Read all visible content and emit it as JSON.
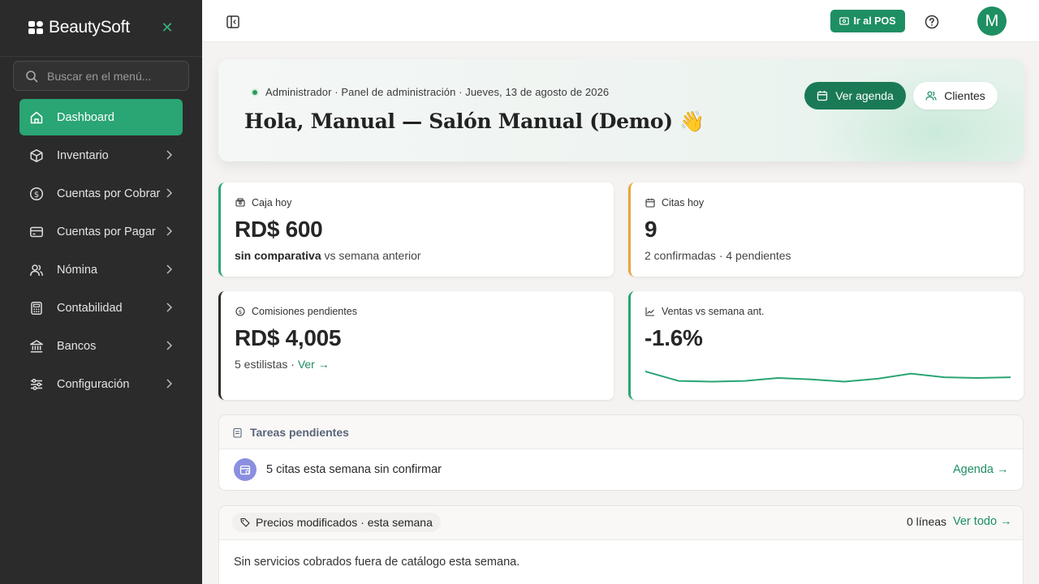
{
  "brand": {
    "name": "BeautySoft"
  },
  "sidebar": {
    "search_placeholder": "Buscar en el menú...",
    "items": [
      {
        "label": "Dashboard",
        "icon": "home-icon",
        "active": true
      },
      {
        "label": "Inventario",
        "icon": "box-icon"
      },
      {
        "label": "Cuentas por Cobrar",
        "icon": "dollar-circle-icon"
      },
      {
        "label": "Cuentas por Pagar",
        "icon": "card-icon"
      },
      {
        "label": "Nómina",
        "icon": "users-icon"
      },
      {
        "label": "Contabilidad",
        "icon": "calculator-icon"
      },
      {
        "label": "Bancos",
        "icon": "bank-icon"
      },
      {
        "label": "Configuración",
        "icon": "sliders-icon"
      }
    ]
  },
  "topbar": {
    "pos_label": "Ir al POS",
    "avatar_initial": "M"
  },
  "hero": {
    "meta": "Administrador · Panel de administración · Jueves, 13 de agosto de 2026",
    "title": "Hola, Manual — Salón Manual (Demo) 👋",
    "agenda_button": "Ver agenda",
    "clients_button": "Clientes"
  },
  "cards": {
    "cash": {
      "label": "Caja hoy",
      "value": "RD$ 600",
      "sub_bold": "sin comparativa",
      "sub_rest": " vs semana anterior",
      "accent": "#2aa574"
    },
    "appointments": {
      "label": "Citas hoy",
      "value": "9",
      "sub": "2 confirmadas · 4 pendientes",
      "accent": "#e8a63a"
    },
    "commissions": {
      "label": "Comisiones pendientes",
      "value": "RD$ 4,005",
      "sub": "5 estilistas · ",
      "link": "Ver →",
      "accent": "#2b2b2b"
    },
    "sales": {
      "label": "Ventas vs semana ant.",
      "value": "-1.6%",
      "accent": "#2aa574",
      "sparkline": [
        0.95,
        0.3,
        0.25,
        0.3,
        0.5,
        0.4,
        0.25,
        0.45,
        0.8,
        0.55,
        0.5,
        0.55
      ]
    }
  },
  "tasks": {
    "title": "Tareas pendientes",
    "items": [
      {
        "text": "5 citas esta semana sin confirmar",
        "link": "Agenda →"
      }
    ]
  },
  "prices": {
    "chip": "Precios modificados · esta semana",
    "count": "0 líneas",
    "see_all": "Ver todo →",
    "empty": "Sin servicios cobrados fuera de catálogo esta semana."
  },
  "colors": {
    "sidebar_bg": "#2b2b2b",
    "primary": "#1e8f62",
    "active": "#2aa574",
    "task_icon": "#8a8fe0"
  }
}
